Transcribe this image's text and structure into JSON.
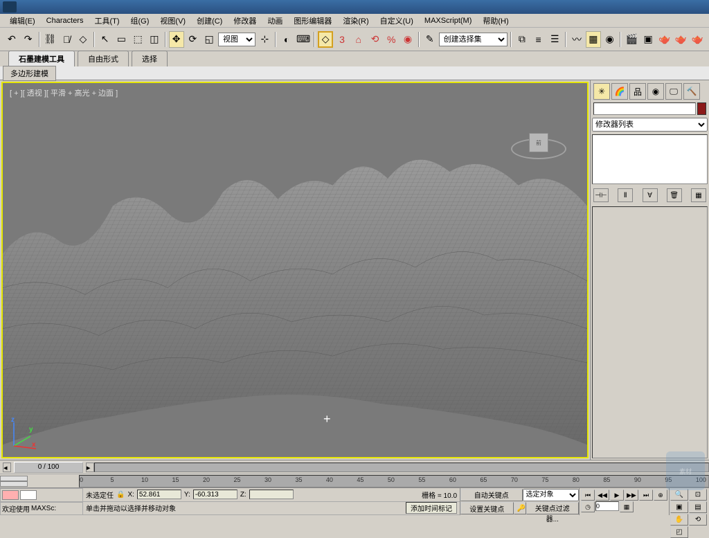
{
  "menu": {
    "edit": "编辑(E)",
    "characters": "Characters",
    "tools": "工具(T)",
    "group": "组(G)",
    "view": "视图(V)",
    "create": "创建(C)",
    "modifiers": "修改器",
    "animation": "动画",
    "grapheditor": "图形编辑器",
    "render": "渲染(R)",
    "customize": "自定义(U)",
    "maxscript": "MAXScript(M)",
    "help": "帮助(H)"
  },
  "toolbar": {
    "viewdrop": "视图",
    "selectset": "创建选择集"
  },
  "tabs": {
    "graphite": "石墨建模工具",
    "freeform": "自由形式",
    "select": "选择"
  },
  "subtabs": {
    "polymodel": "多边形建模"
  },
  "viewport": {
    "label": "[ + ][ 透视 ][ 平滑 + 高光 + 边面 ]",
    "cubeface": "前"
  },
  "sidepanel": {
    "modlist": "修改器列表"
  },
  "timeline": {
    "framelabel": "0 / 100",
    "ticks": [
      "0",
      "5",
      "10",
      "15",
      "20",
      "25",
      "30",
      "35",
      "40",
      "45",
      "50",
      "55",
      "60",
      "65",
      "70",
      "75",
      "80",
      "85",
      "90",
      "95",
      "100"
    ]
  },
  "status": {
    "welcome": "欢迎使用",
    "maxsc": "MAXSc:",
    "noselect": "未选定任",
    "hint": "单击并拖动以选择并移动对象",
    "x_label": "X:",
    "x_val": "52.861",
    "y_label": "Y:",
    "y_val": "-60.313",
    "z_label": "Z:",
    "z_val": "",
    "grid_label": "栅格 = 10.0",
    "addtimemark": "添加时间标记",
    "autokey": "自动关键点",
    "setkey": "设置关键点",
    "selobj": "选定对象",
    "keyfilter": "关键点过滤器..."
  },
  "axis": {
    "x": "x",
    "y": "y",
    "z": "z"
  }
}
